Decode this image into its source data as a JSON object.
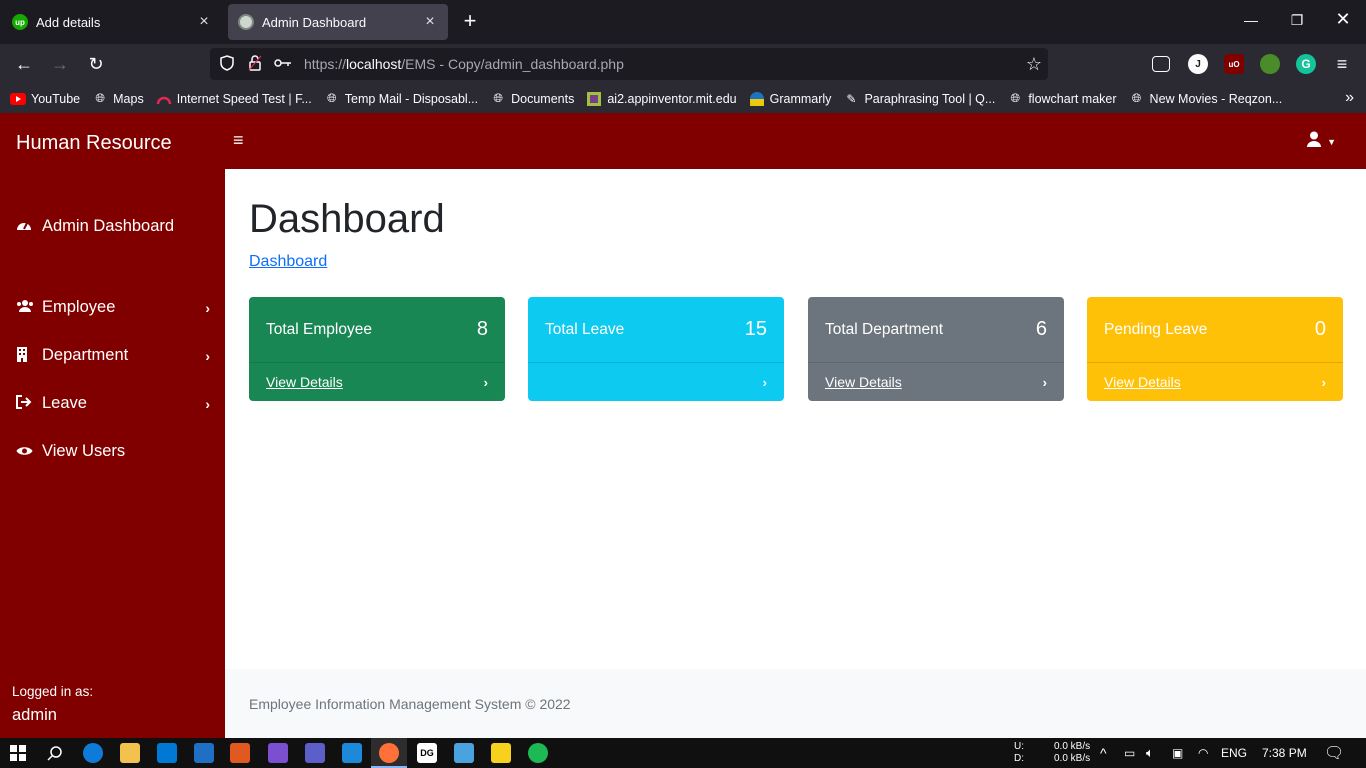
{
  "browser": {
    "tabs": [
      {
        "title": "Add details",
        "active": false
      },
      {
        "title": "Admin Dashboard",
        "active": true
      }
    ],
    "url_prefix": "https://",
    "url_host": "localhost",
    "url_path": "/EMS - Copy/admin_dashboard.php",
    "bookmarks": [
      {
        "label": "YouTube",
        "icon": "youtube-icon"
      },
      {
        "label": "Maps",
        "icon": "globe-icon"
      },
      {
        "label": "Internet Speed Test | F...",
        "icon": "speedometer-icon"
      },
      {
        "label": "Temp Mail - Disposabl...",
        "icon": "globe-icon"
      },
      {
        "label": "Documents",
        "icon": "globe-icon"
      },
      {
        "label": "ai2.appinventor.mit.edu",
        "icon": "appinventor-icon"
      },
      {
        "label": "Grammarly",
        "icon": "grammarly-icon"
      },
      {
        "label": "Paraphrasing Tool | Q...",
        "icon": "quill-icon"
      },
      {
        "label": "flowchart maker",
        "icon": "globe-icon"
      },
      {
        "label": "New Movies - Reqzon...",
        "icon": "globe-icon"
      }
    ],
    "profile_initial": "J"
  },
  "app": {
    "brand": "Human Resource",
    "sidebar": {
      "items": [
        {
          "label": "Admin Dashboard",
          "icon": "dashboard-gauge-icon",
          "has_chevron": false
        },
        {
          "label": "Employee",
          "icon": "users-icon",
          "has_chevron": true
        },
        {
          "label": "Department",
          "icon": "building-icon",
          "has_chevron": true
        },
        {
          "label": "Leave",
          "icon": "sign-out-icon",
          "has_chevron": true
        },
        {
          "label": "View Users",
          "icon": "eye-icon",
          "has_chevron": false
        }
      ],
      "logged_in_label": "Logged in as:",
      "logged_in_user": "admin"
    },
    "page_title": "Dashboard",
    "breadcrumb": "Dashboard",
    "cards": [
      {
        "title": "Total Employee",
        "count": "8",
        "footer": "View Details",
        "color": "#198754"
      },
      {
        "title": "Total Leave",
        "count": "15",
        "footer": "",
        "color": "#0dcaf0"
      },
      {
        "title": "Total Department",
        "count": "6",
        "footer": "View Details",
        "color": "#6c757d"
      },
      {
        "title": "Pending Leave",
        "count": "0",
        "footer": "View Details",
        "color": "#ffc107"
      }
    ],
    "footer_text": "Employee Information Management System © 2022",
    "theme_color": "#800000"
  },
  "taskbar": {
    "net_up_label": "U:",
    "net_down_label": "D:",
    "net_up": "0.0 kB/s",
    "net_down": "0.0 kB/s",
    "language": "ENG",
    "time": "7:38 PM"
  }
}
